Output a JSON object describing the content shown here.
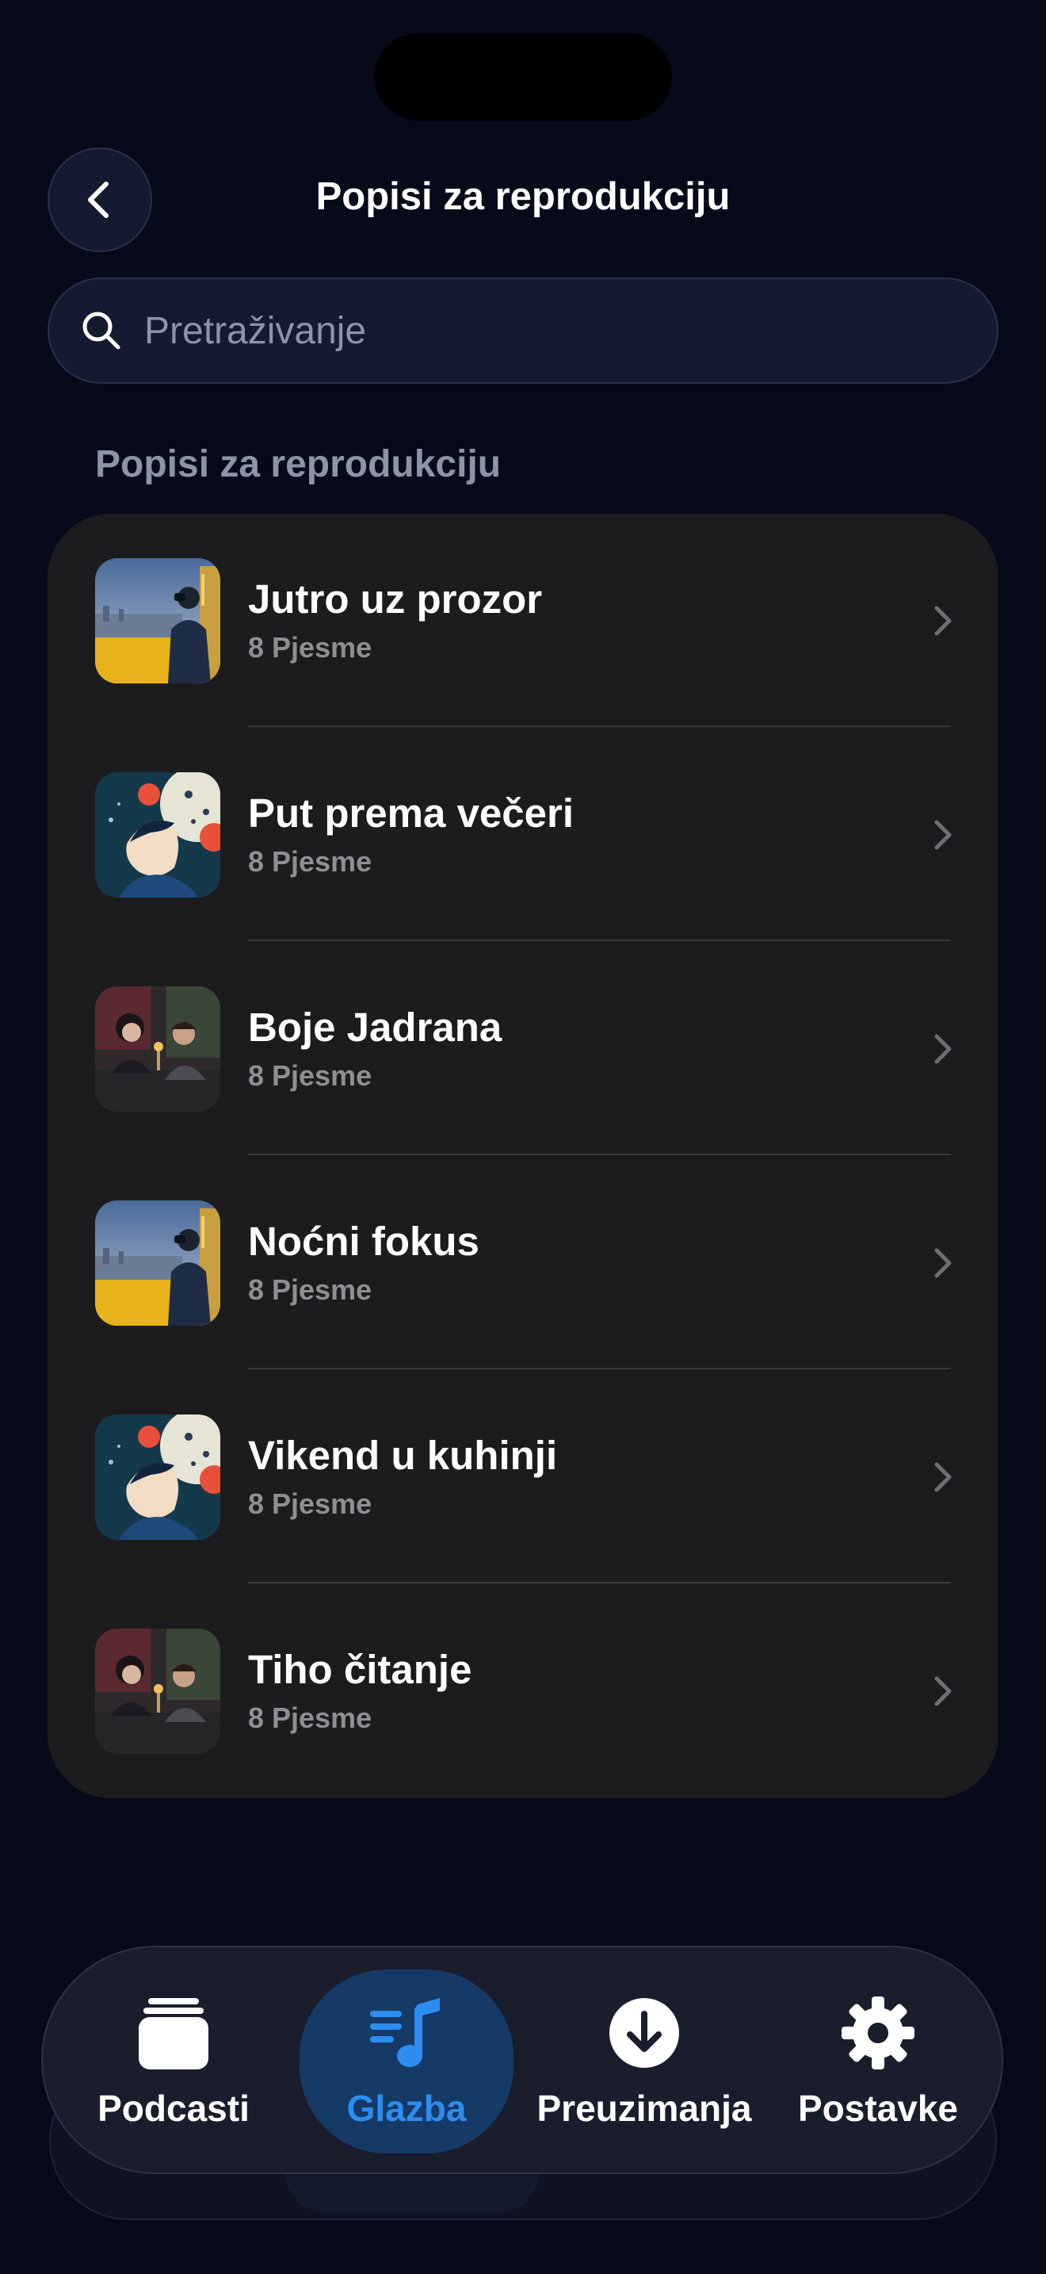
{
  "header": {
    "title": "Popisi za reprodukciju",
    "back_icon": "chevron-left-icon"
  },
  "search": {
    "placeholder": "Pretraživanje",
    "icon": "search-icon"
  },
  "section": {
    "title": "Popisi za reprodukciju"
  },
  "playlists": [
    {
      "title": "Jutro uz prozor",
      "subtitle": "8 Pjesme",
      "artwork": "city-window"
    },
    {
      "title": "Put prema večeri",
      "subtitle": "8 Pjesme",
      "artwork": "illustration"
    },
    {
      "title": "Boje Jadrana",
      "subtitle": "8 Pjesme",
      "artwork": "dinner"
    },
    {
      "title": "Noćni fokus",
      "subtitle": "8 Pjesme",
      "artwork": "city-window"
    },
    {
      "title": "Vikend u kuhinji",
      "subtitle": "8 Pjesme",
      "artwork": "illustration"
    },
    {
      "title": "Tiho čitanje",
      "subtitle": "8 Pjesme",
      "artwork": "dinner"
    }
  ],
  "tabbar": {
    "items": [
      {
        "label": "Podcasti",
        "icon": "stack-icon",
        "active": false
      },
      {
        "label": "Glazba",
        "icon": "music-note-list-icon",
        "active": true
      },
      {
        "label": "Preuzimanja",
        "icon": "download-circle-icon",
        "active": false
      },
      {
        "label": "Postavke",
        "icon": "gear-icon",
        "active": false
      }
    ]
  },
  "colors": {
    "background": "#070a18",
    "card": "#1c1c1e",
    "accent": "#2d8cf0",
    "secondary_text": "#8e8e93"
  }
}
